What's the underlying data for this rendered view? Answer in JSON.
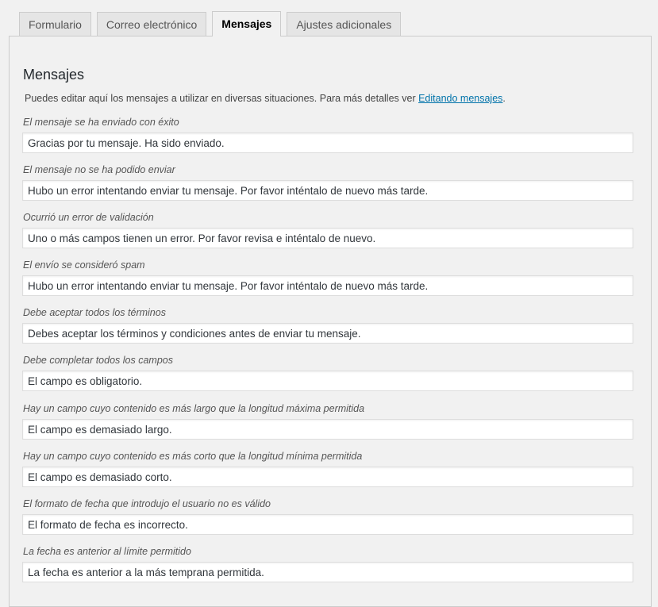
{
  "tabs": [
    {
      "label": "Formulario",
      "active": false
    },
    {
      "label": "Correo electrónico",
      "active": false
    },
    {
      "label": "Mensajes",
      "active": true
    },
    {
      "label": "Ajustes adicionales",
      "active": false
    }
  ],
  "panel": {
    "title": "Mensajes",
    "description_before": "Puedes editar aquí los mensajes a utilizar en diversas situaciones. Para más detalles ver ",
    "description_link": "Editando mensajes",
    "description_after": "."
  },
  "messages": [
    {
      "label": "El mensaje se ha enviado con éxito",
      "value": "Gracias por tu mensaje. Ha sido enviado."
    },
    {
      "label": "El mensaje no se ha podido enviar",
      "value": "Hubo un error intentando enviar tu mensaje. Por favor inténtalo de nuevo más tarde."
    },
    {
      "label": "Ocurrió un error de validación",
      "value": "Uno o más campos tienen un error. Por favor revisa e inténtalo de nuevo."
    },
    {
      "label": "El envío se consideró spam",
      "value": "Hubo un error intentando enviar tu mensaje. Por favor inténtalo de nuevo más tarde."
    },
    {
      "label": "Debe aceptar todos los términos",
      "value": "Debes aceptar los términos y condiciones antes de enviar tu mensaje."
    },
    {
      "label": "Debe completar todos los campos",
      "value": "El campo es obligatorio."
    },
    {
      "label": "Hay un campo cuyo contenido es más largo que la longitud máxima permitida",
      "value": "El campo es demasiado largo."
    },
    {
      "label": "Hay un campo cuyo contenido es más corto que la longitud mínima permitida",
      "value": "El campo es demasiado corto."
    },
    {
      "label": "El formato de fecha que introdujo el usuario no es válido",
      "value": "El formato de fecha es incorrecto."
    },
    {
      "label": "La fecha es anterior al límite permitido",
      "value": "La fecha es anterior a la más temprana permitida."
    }
  ]
}
